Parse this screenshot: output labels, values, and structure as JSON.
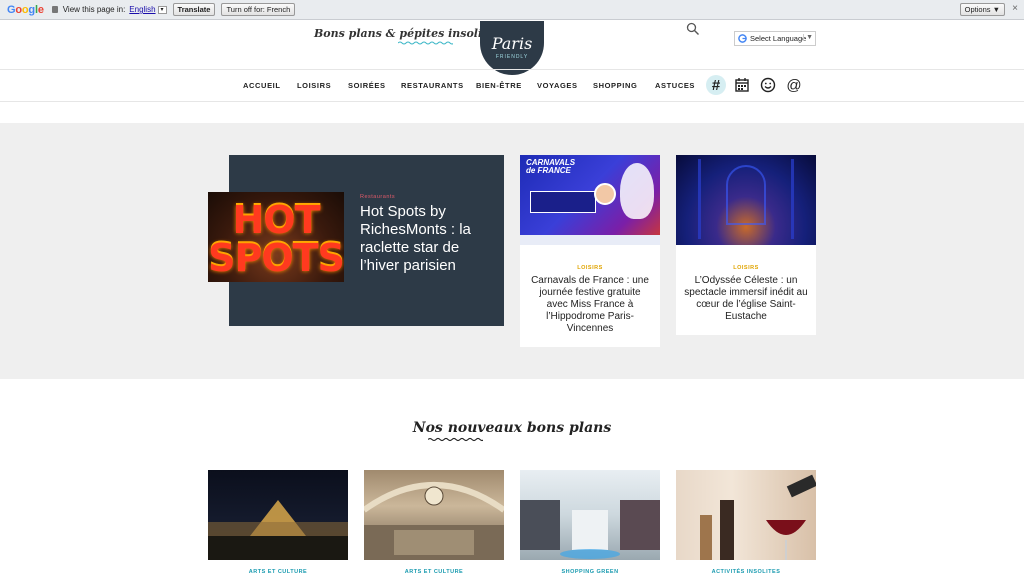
{
  "translate_bar": {
    "view_text": "View this page in:",
    "language": "English",
    "translate_label": "Translate",
    "turn_off_label": "Turn off for: French",
    "options_label": "Options ▼"
  },
  "header": {
    "tagline": "Bons plans & pépites insolites",
    "logo_text": "Paris",
    "logo_subtext": "FRIENDLY",
    "language_select": "Select Language"
  },
  "nav": {
    "items": [
      "ACCUEIL",
      "LOISIRS",
      "SOIRÉES",
      "RESTAURANTS",
      "BIEN-ÊTRE",
      "VOYAGES",
      "SHOPPING",
      "ASTUCES"
    ],
    "icons": [
      "hashtag-icon",
      "calendar-icon",
      "smiley-icon",
      "at-icon"
    ]
  },
  "featured": {
    "hero": {
      "category": "Restaurants",
      "title": "Hot Spots by RichesMonts : la raclette star de l’hiver parisien",
      "image_text": "HOT SPOTS"
    },
    "cards": [
      {
        "category": "LOISIRS",
        "title": "Carnavals de France : une journée festive gratuite avec Miss France à l’Hippodrome Paris-Vincennes",
        "image_text": "CARNAVALS DE FRANCE"
      },
      {
        "category": "LOISIRS",
        "title": "L’Odyssée Céleste : un spectacle immersif inédit au cœur de l’église Saint-Eustache"
      }
    ]
  },
  "new_deals": {
    "title": "Nos nouveaux bons plans",
    "tiles": [
      {
        "category": "ARTS ET CULTURE"
      },
      {
        "category": "ARTS ET CULTURE"
      },
      {
        "category": "SHOPPING GREEN"
      },
      {
        "category": "ACTIVITÉS INSOLITES"
      }
    ]
  },
  "colors": {
    "dark_navy": "#2d3a47",
    "band_gray": "#efefef",
    "accent_teal": "#1a9bb0",
    "accent_yellow": "#e0a400",
    "accent_pink": "#e05a6a"
  }
}
